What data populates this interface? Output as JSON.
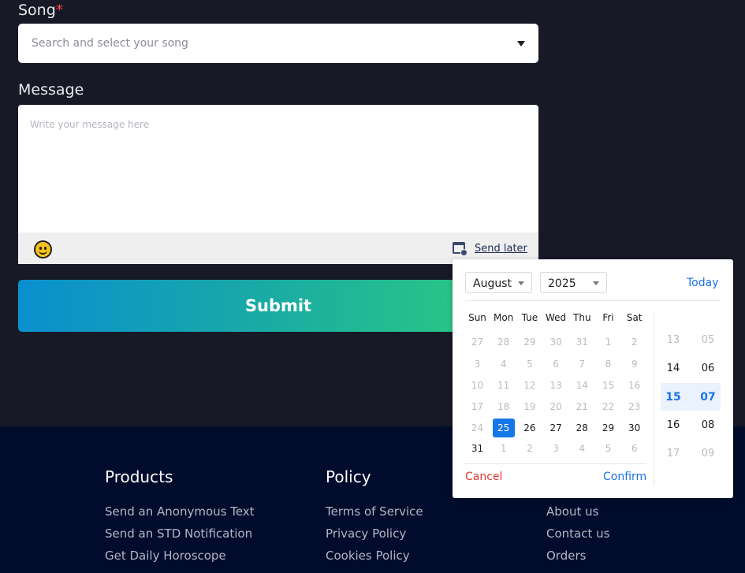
{
  "form": {
    "song_label": "Song",
    "song_required_mark": "*",
    "song_placeholder": "Search and select your song",
    "message_label": "Message",
    "message_placeholder": "Write your message here",
    "send_later": "Send later",
    "submit": "Submit"
  },
  "footer": {
    "columns": [
      {
        "title": "Products",
        "links": [
          "Send an Anonymous Text",
          "Send an STD Notification",
          "Get Daily Horoscope"
        ]
      },
      {
        "title": "Policy",
        "links": [
          "Terms of Service",
          "Privacy Policy",
          "Cookies Policy"
        ]
      },
      {
        "title": "",
        "links": [
          "About us",
          "Contact us",
          "Orders"
        ]
      }
    ]
  },
  "picker": {
    "month": "August",
    "year": "2025",
    "today": "Today",
    "weekdays": [
      "Sun",
      "Mon",
      "Tue",
      "Wed",
      "Thu",
      "Fri",
      "Sat"
    ],
    "weeks": [
      [
        "27",
        "28",
        "29",
        "30",
        "31",
        "1",
        "2"
      ],
      [
        "3",
        "4",
        "5",
        "6",
        "7",
        "8",
        "9"
      ],
      [
        "10",
        "11",
        "12",
        "13",
        "14",
        "15",
        "16"
      ],
      [
        "17",
        "18",
        "19",
        "20",
        "21",
        "22",
        "23"
      ],
      [
        "24",
        "25",
        "26",
        "27",
        "28",
        "29",
        "30"
      ],
      [
        "31",
        "1",
        "2",
        "3",
        "4",
        "5",
        "6"
      ]
    ],
    "selected_day": "25",
    "hours": [
      "13",
      "14",
      "15",
      "16",
      "17"
    ],
    "minutes": [
      "05",
      "06",
      "07",
      "08",
      "09"
    ],
    "selected_hour": "15",
    "selected_minute": "07",
    "cancel": "Cancel",
    "confirm": "Confirm",
    "colors": {
      "accent": "#1677e8",
      "cancel": "#e53935"
    }
  }
}
